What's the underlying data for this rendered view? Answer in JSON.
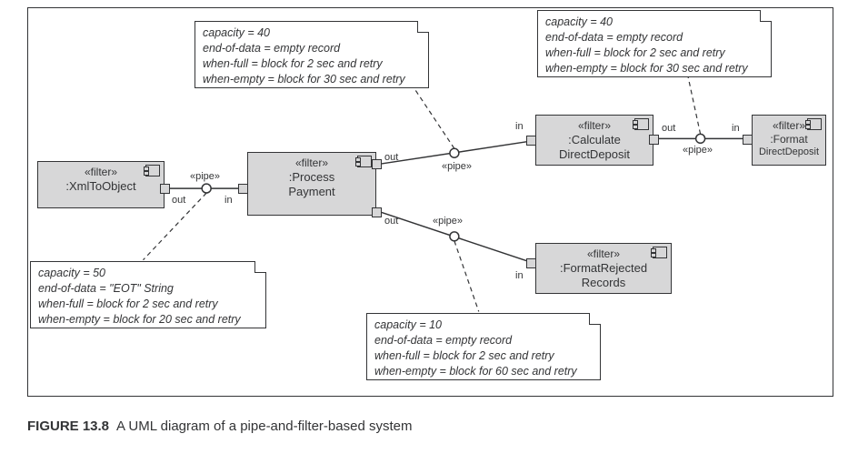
{
  "caption_label": "FIGURE 13.8",
  "caption_text": "A UML diagram of a pipe-and-filter-based system",
  "stereotypes": {
    "filter": "«filter»",
    "pipe": "«pipe»"
  },
  "port_labels": {
    "in": "in",
    "out": "out"
  },
  "filters": {
    "xml": {
      "name": ":XmlToObject"
    },
    "process": {
      "name": ":Process",
      "name2": "Payment"
    },
    "calc": {
      "name": ":Calculate",
      "name2": "DirectDeposit"
    },
    "format": {
      "name": ":Format",
      "name2": "DirectDeposit"
    },
    "reject": {
      "name": ":FormatRejected",
      "name2": "Records"
    }
  },
  "notes": {
    "top_left": {
      "l1": "capacity = 40",
      "l2": "end-of-data = empty record",
      "l3": "when-full = block for 2 sec and retry",
      "l4": "when-empty = block for 30 sec and retry"
    },
    "top_right": {
      "l1": "capacity = 40",
      "l2": "end-of-data = empty record",
      "l3": "when-full = block for 2 sec and retry",
      "l4": "when-empty = block for 30 sec and retry"
    },
    "bottom_left": {
      "l1": "capacity = 50",
      "l2": "end-of-data = \"EOT\" String",
      "l3": "when-full = block for 2 sec and retry",
      "l4": "when-empty = block for 20 sec and retry"
    },
    "bottom_mid": {
      "l1": "capacity = 10",
      "l2": "end-of-data = empty record",
      "l3": "when-full = block for 2 sec and retry",
      "l4": "when-empty = block for 60 sec and retry"
    }
  }
}
